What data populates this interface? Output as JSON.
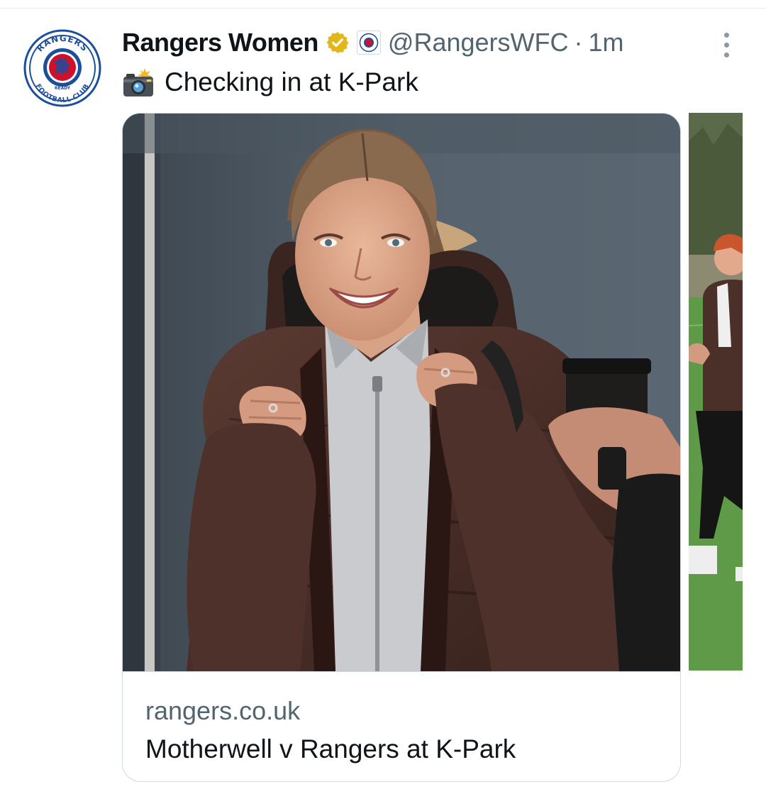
{
  "tweet": {
    "display_name": "Rangers Women",
    "handle": "@RangersWFC",
    "separator": "·",
    "time": "1m",
    "text": "Checking in at K-Park",
    "text_emoji_icon": "camera-with-flash-icon",
    "verified": true,
    "avatar_text_top": "RANGERS",
    "avatar_text_bottom": "FOOTBALL CLUB",
    "avatar_text_ready": "READY"
  },
  "link_card": {
    "domain": "rangers.co.uk",
    "title": "Motherwell v Rangers at K-Park"
  },
  "colors": {
    "primary_text": "#0f1419",
    "secondary_text": "#536471",
    "border": "#cfd9de",
    "verified_gold": "#e2b719",
    "rangers_blue": "#1b4f9c",
    "rangers_red": "#d0102b",
    "jacket_brown": "#4a3029",
    "wall_slate": "#4f5a64",
    "pitch_green": "#5f9a48"
  }
}
